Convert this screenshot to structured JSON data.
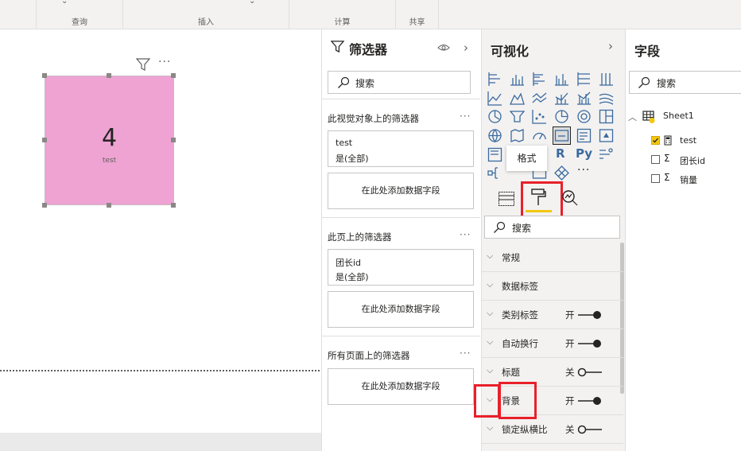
{
  "ribbon": {
    "groups": [
      "查询",
      "插入",
      "计算",
      "共享"
    ]
  },
  "canvas": {
    "card": {
      "value": "4",
      "label": "test",
      "color": "#efa3d3"
    },
    "more_label": "···"
  },
  "filter_pane": {
    "title": "筛选器",
    "search_placeholder": "搜索",
    "sections": [
      {
        "title": "此视觉对象上的筛选器",
        "cards": [
          {
            "field": "test",
            "value": "是(全部)"
          }
        ],
        "add_label": "在此处添加数据字段"
      },
      {
        "title": "此页上的筛选器",
        "cards": [
          {
            "field": "团长id",
            "value": "是(全部)"
          }
        ],
        "add_label": "在此处添加数据字段"
      },
      {
        "title": "所有页面上的筛选器",
        "cards": [],
        "add_label": "在此处添加数据字段"
      }
    ],
    "more_label": "···"
  },
  "viz_pane": {
    "title": "可视化",
    "tooltip": "格式",
    "search_placeholder": "搜索",
    "r_label": "R",
    "py_label": "Py",
    "more_label": "···",
    "props": [
      {
        "label": "常规",
        "toggle": null
      },
      {
        "label": "数据标签",
        "toggle": null
      },
      {
        "label": "类别标签",
        "toggle": "开"
      },
      {
        "label": "自动换行",
        "toggle": "开"
      },
      {
        "label": "标题",
        "toggle": "关"
      },
      {
        "label": "背景",
        "toggle": "开"
      },
      {
        "label": "锁定纵横比",
        "toggle": "关"
      }
    ],
    "accent_color": "#f2c811",
    "highlight_color": "#e8202a"
  },
  "fields_pane": {
    "title": "字段",
    "search_placeholder": "搜索",
    "table": {
      "name": "Sheet1",
      "fields": [
        {
          "name": "test",
          "checked": true,
          "icon": "calculator-icon"
        },
        {
          "name": "团长id",
          "checked": false,
          "icon": "sigma-icon"
        },
        {
          "name": "销量",
          "checked": false,
          "icon": "sigma-icon"
        }
      ]
    }
  }
}
